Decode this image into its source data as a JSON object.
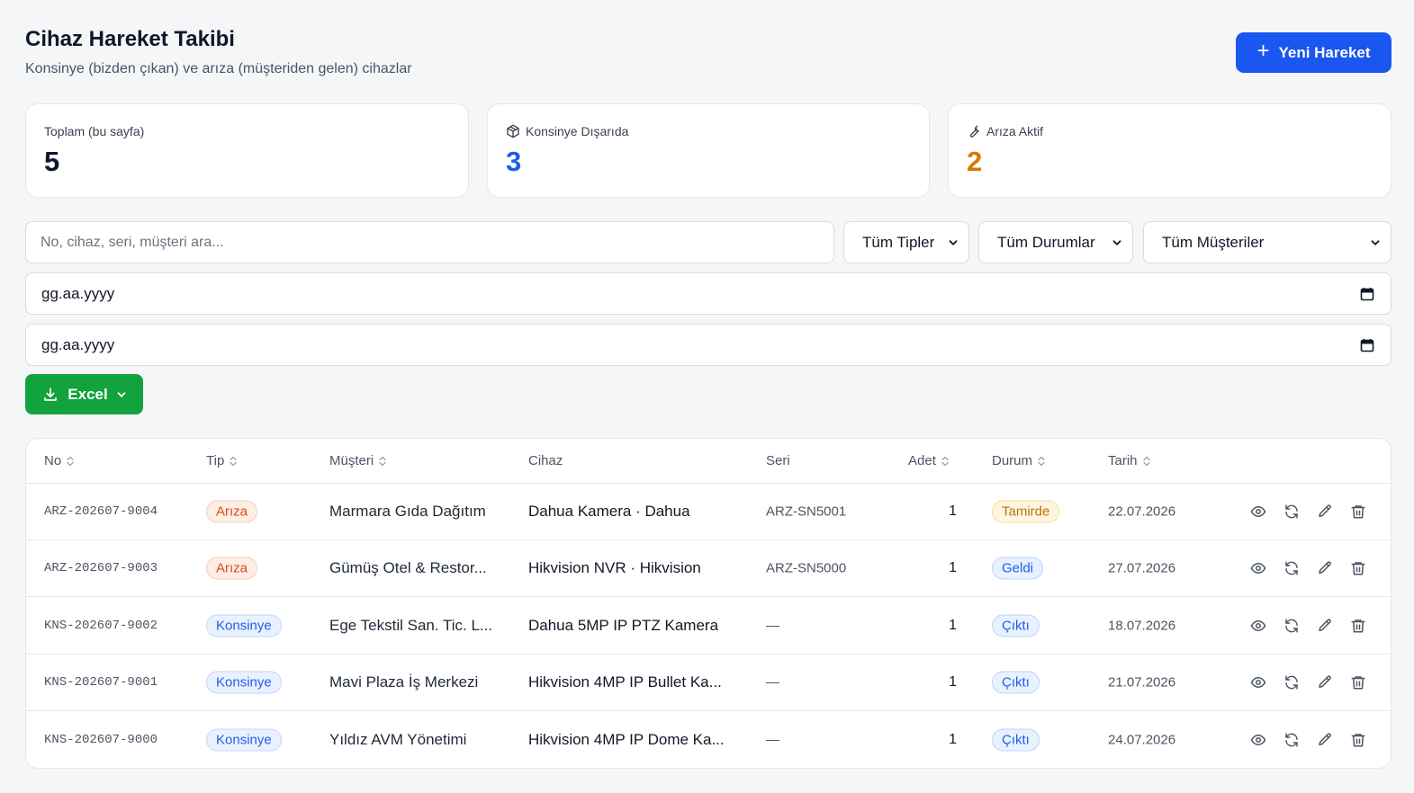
{
  "header": {
    "title": "Cihaz Hareket Takibi",
    "subtitle": "Konsinye (bizden çıkan) ve arıza (müşteriden gelen) cihazlar",
    "new_button": "Yeni Hareket"
  },
  "stats": {
    "total_label": "Toplam (bu sayfa)",
    "total_value": "5",
    "konsinye_label": "Konsinye Dışarıda",
    "konsinye_value": "3",
    "ariza_label": "Arıza Aktif",
    "ariza_value": "2",
    "colors": {
      "konsinye": "#1d5ee8",
      "ariza": "#d97706"
    }
  },
  "filters": {
    "search_placeholder": "No, cihaz, seri, müşteri ara...",
    "type_select": "Tüm Tipler",
    "status_select": "Tüm Durumlar",
    "customer_select": "Tüm Müşteriler",
    "date_from": "gg.aa.yyyy",
    "date_to": "gg.aa.yyyy",
    "excel_button": "Excel"
  },
  "table": {
    "columns": {
      "no": "No",
      "tip": "Tip",
      "musteri": "Müşteri",
      "cihaz": "Cihaz",
      "seri": "Seri",
      "adet": "Adet",
      "durum": "Durum",
      "tarih": "Tarih"
    },
    "rows": [
      {
        "no": "ARZ-202607-9004",
        "tip": "Arıza",
        "musteri": "Marmara Gıda Dağıtım",
        "cihaz": "Dahua Kamera · Dahua",
        "seri": "ARZ-SN5001",
        "adet": "1",
        "durum": "Tamirde",
        "tarih": "22.07.2026"
      },
      {
        "no": "ARZ-202607-9003",
        "tip": "Arıza",
        "musteri": "Gümüş Otel & Restor...",
        "cihaz": "Hikvision NVR · Hikvision",
        "seri": "ARZ-SN5000",
        "adet": "1",
        "durum": "Geldi",
        "tarih": "27.07.2026"
      },
      {
        "no": "KNS-202607-9002",
        "tip": "Konsinye",
        "musteri": "Ege Tekstil San. Tic. L...",
        "cihaz": "Dahua 5MP IP PTZ Kamera",
        "seri": "—",
        "adet": "1",
        "durum": "Çıktı",
        "tarih": "18.07.2026"
      },
      {
        "no": "KNS-202607-9001",
        "tip": "Konsinye",
        "musteri": "Mavi Plaza İş Merkezi",
        "cihaz": "Hikvision 4MP IP Bullet Ka...",
        "seri": "—",
        "adet": "1",
        "durum": "Çıktı",
        "tarih": "21.07.2026"
      },
      {
        "no": "KNS-202607-9000",
        "tip": "Konsinye",
        "musteri": "Yıldız AVM Yönetimi",
        "cihaz": "Hikvision 4MP IP Dome Ka...",
        "seri": "—",
        "adet": "1",
        "durum": "Çıktı",
        "tarih": "24.07.2026"
      }
    ]
  }
}
